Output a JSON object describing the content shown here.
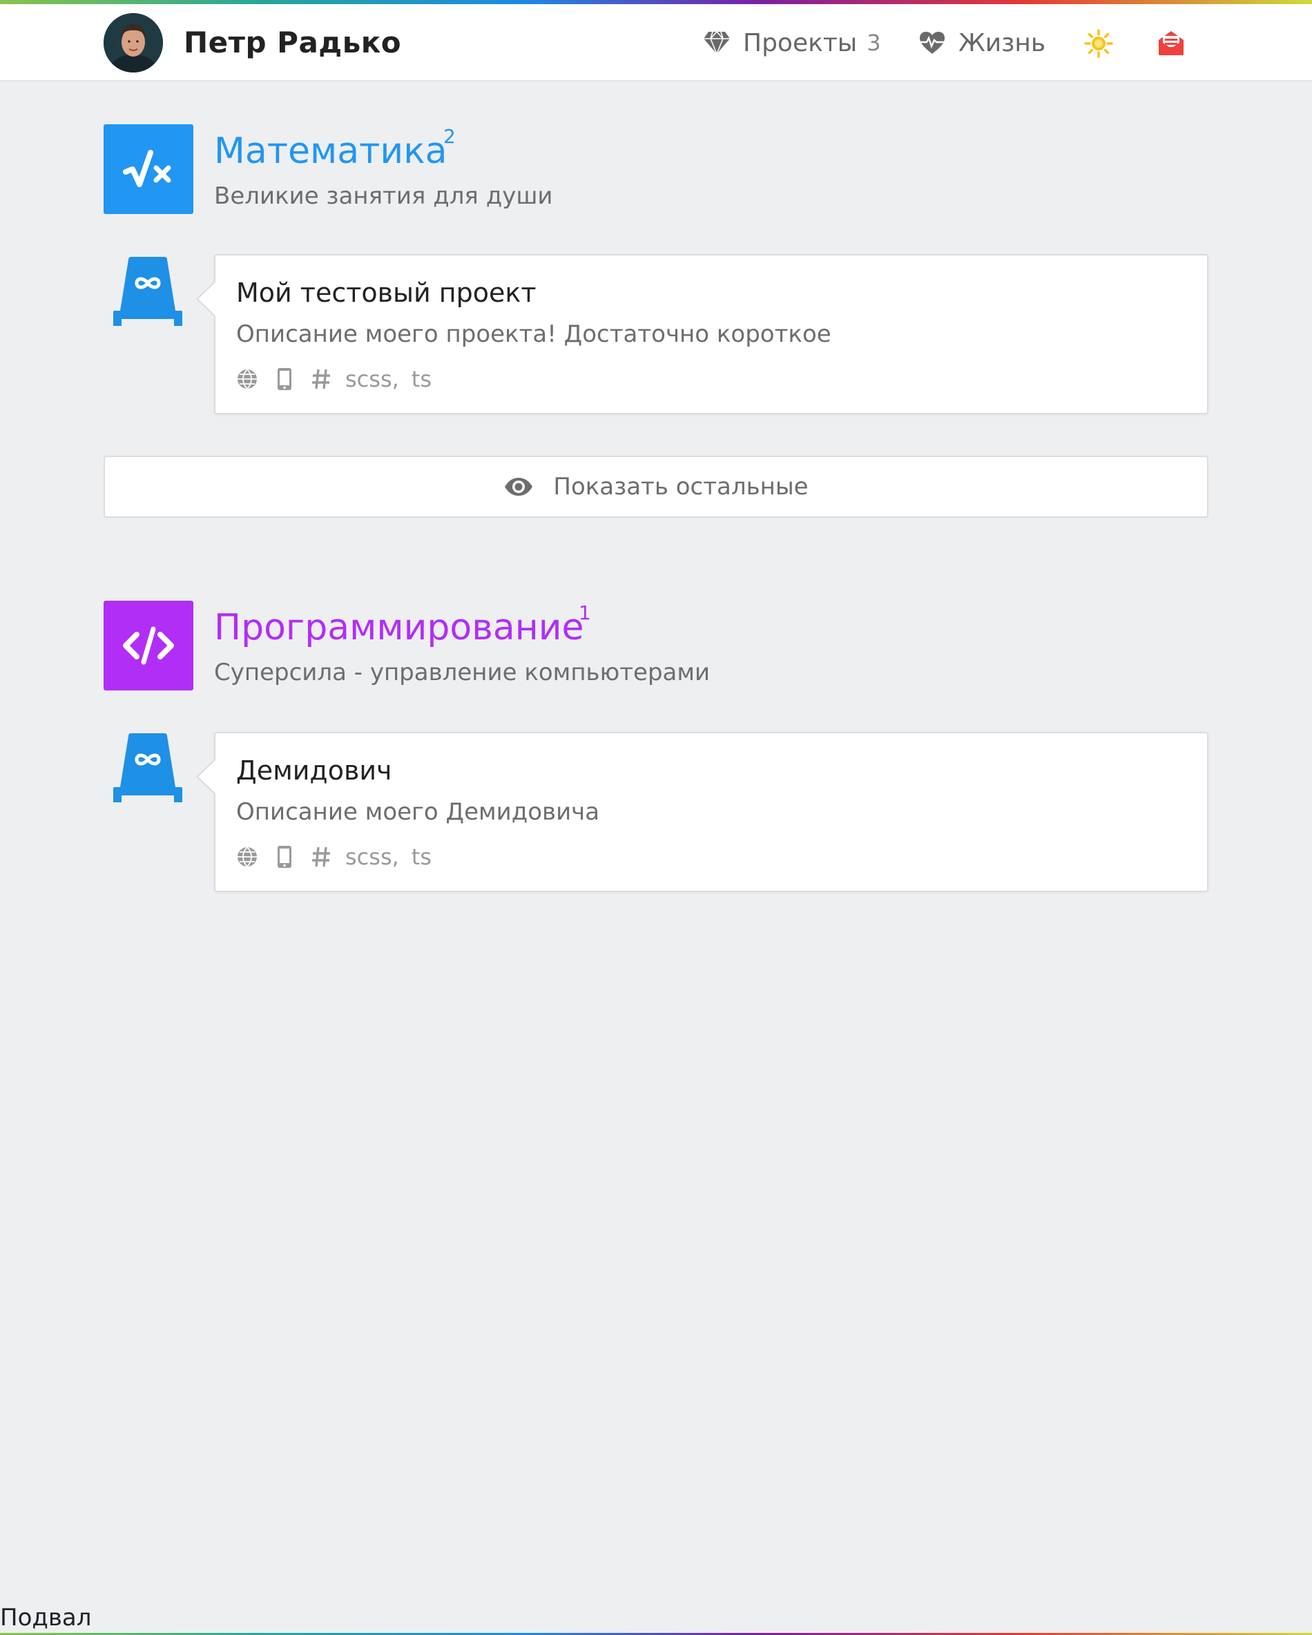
{
  "header": {
    "site_title": "Петр Радько",
    "avatar_icon": "avatar-photo",
    "nav": [
      {
        "label": "Проекты",
        "count": "3",
        "icon": "diamond-icon"
      },
      {
        "label": "Жизнь",
        "icon": "heartbeat-icon"
      }
    ],
    "theme_icon": "sun-icon",
    "mail_icon": "envelope-open-icon"
  },
  "categories": [
    {
      "title": "Математика",
      "count": "2",
      "description": "Великие занятия для души",
      "color": "#2196f3",
      "icon": "square-root-icon",
      "projects": [
        {
          "title": "Мой тестовый проект",
          "description": "Описание моего проекта! Достаточно короткое",
          "tags": [
            "scss,",
            "ts"
          ]
        }
      ],
      "show_more_label": "Показать остальные"
    },
    {
      "title": "Программирование",
      "count": "1",
      "description": "Суперсила - управление компьютерами",
      "color": "#b12ef7",
      "icon": "code-icon",
      "projects": [
        {
          "title": "Демидович",
          "description": "Описание моего Демидовича",
          "tags": [
            "scss,",
            "ts"
          ]
        }
      ]
    }
  ],
  "footer": {
    "text": "Подвал"
  },
  "colors": {
    "background": "#eeeff1",
    "math_blue": "#2196f3",
    "prog_purple": "#b12ef7",
    "sun_yellow": "#f5c518",
    "mail_red": "#f0413c",
    "project_icon_blue": "#1e90e6"
  }
}
